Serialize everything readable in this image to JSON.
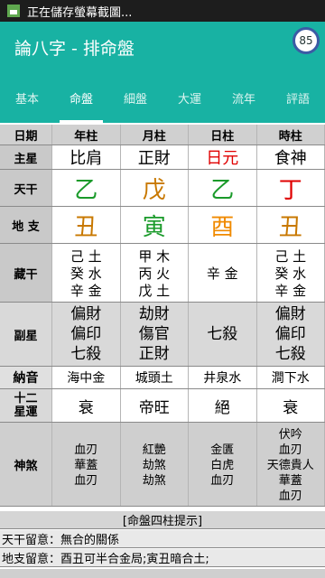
{
  "status_bar": {
    "text": "正在儲存螢幕截圖...",
    "icon": "image-icon"
  },
  "app_bar": {
    "title": "論八字 - 排命盤",
    "badge": "85"
  },
  "tabs": [
    {
      "label": "基本"
    },
    {
      "label": "命盤",
      "active": true
    },
    {
      "label": "細盤"
    },
    {
      "label": "大運"
    },
    {
      "label": "流年"
    },
    {
      "label": "評語"
    }
  ],
  "header": {
    "label": "日期",
    "cols": [
      "年柱",
      "月柱",
      "日柱",
      "時柱"
    ]
  },
  "main_star": {
    "label": "主星",
    "cols": [
      "比肩",
      "正財",
      "日元",
      "食神"
    ],
    "colors": [
      "#000000",
      "#000000",
      "#e00000",
      "#000000"
    ]
  },
  "tian_gan": {
    "label": "天干",
    "cols": [
      "乙",
      "戊",
      "乙",
      "丁"
    ],
    "colors": [
      "#1a9a2a",
      "#c87800",
      "#1a9a2a",
      "#e00000"
    ]
  },
  "di_zhi": {
    "label": "地 支",
    "cols": [
      "丑",
      "寅",
      "酉",
      "丑"
    ],
    "colors": [
      "#c87800",
      "#1a9a2a",
      "#f08a00",
      "#c87800"
    ]
  },
  "cang_gan": {
    "label": "藏干",
    "cols": [
      [
        "己 土",
        "癸 水",
        "辛 金"
      ],
      [
        "甲 木",
        "丙 火",
        "戊 土"
      ],
      [
        "辛 金"
      ],
      [
        "己 土",
        "癸 水",
        "辛 金"
      ]
    ]
  },
  "fu_xing": {
    "label": "副星",
    "cols": [
      [
        "偏財",
        "偏印",
        "七殺"
      ],
      [
        "劫財",
        "傷官",
        "正財"
      ],
      [
        "七殺"
      ],
      [
        "偏財",
        "偏印",
        "七殺"
      ]
    ]
  },
  "na_yin": {
    "label": "納音",
    "cols": [
      "海中金",
      "城頭土",
      "井泉水",
      "澗下水"
    ]
  },
  "xing_yun": {
    "label_1": "十二",
    "label_2": "星運",
    "cols": [
      "衰",
      "帝旺",
      "絕",
      "衰"
    ]
  },
  "shen_sha": {
    "label": "神煞",
    "cols": [
      [
        "血刃",
        "華蓋",
        "血刃"
      ],
      [
        "紅艷",
        "劫煞",
        "劫煞"
      ],
      [
        "金匱",
        "白虎",
        "血刃"
      ],
      [
        "伏吟",
        "血刃",
        "天德貴人",
        "華蓋",
        "血刃"
      ]
    ]
  },
  "hint": "[命盤四柱提示]",
  "notes": [
    "天干留意：無合的關係",
    "地支留意：酉丑可半合金局;寅丑暗合土;"
  ]
}
